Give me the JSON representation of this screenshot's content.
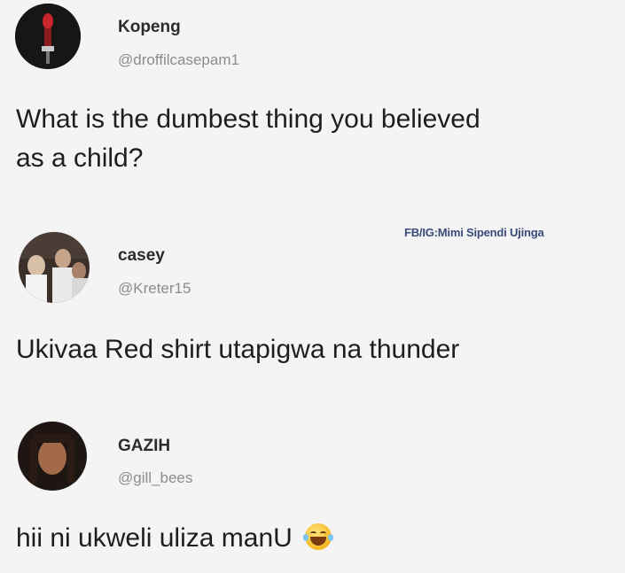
{
  "watermark": "FB/IG:Mimi Sipendi Ujinga",
  "posts": [
    {
      "name": "Kopeng",
      "handle": "@droffilcasepam1",
      "text_line1": "What is the dumbest thing you believed",
      "text_line2": "as a child?"
    },
    {
      "name": "casey",
      "handle": "@Kreter15",
      "text_line1": "Ukivaa Red shirt utapigwa na thunder"
    },
    {
      "name": "GAZIH",
      "handle": "@gill_bees",
      "text_line1": "hii ni ukweli uliza manU",
      "emoji": "laughing-tears-emoji"
    }
  ]
}
